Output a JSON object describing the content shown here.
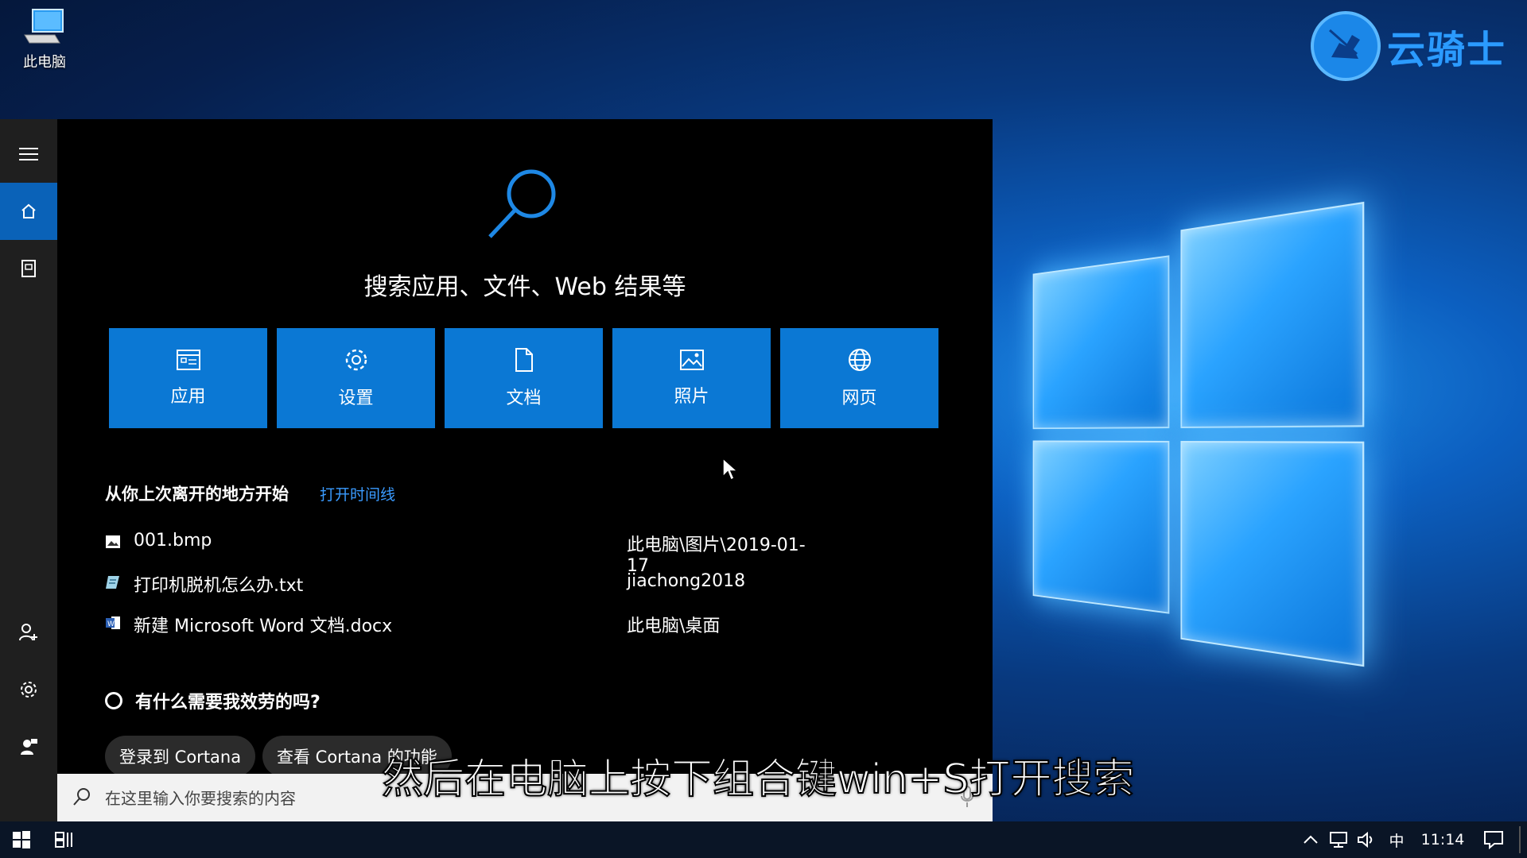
{
  "desktop": {
    "icon_label": "此电脑"
  },
  "brand": {
    "text": "云骑士"
  },
  "search_panel": {
    "headline": "搜索应用、文件、Web 结果等",
    "tiles": [
      {
        "label": "应用",
        "icon": "apps-icon"
      },
      {
        "label": "设置",
        "icon": "gear-icon"
      },
      {
        "label": "文档",
        "icon": "document-icon"
      },
      {
        "label": "照片",
        "icon": "photo-icon"
      },
      {
        "label": "网页",
        "icon": "globe-icon"
      }
    ],
    "recent": {
      "title": "从你上次离开的地方开始",
      "link": "打开时间线",
      "files": [
        {
          "name": "001.bmp",
          "path": "此电脑\\图片\\2019-01-17",
          "icon": "image-file-icon"
        },
        {
          "name": "打印机脱机怎么办.txt",
          "path": "jiachong2018",
          "icon": "text-file-icon"
        },
        {
          "name": "新建 Microsoft Word 文档.docx",
          "path": "此电脑\\桌面",
          "icon": "word-file-icon"
        }
      ]
    },
    "cortana": {
      "question": "有什么需要我效劳的吗?",
      "buttons": [
        "登录到 Cortana",
        "查看 Cortana 的功能"
      ]
    },
    "search_box": {
      "placeholder": "在这里输入你要搜索的内容",
      "value": ""
    }
  },
  "subtitle": "然后在电脑上按下组合键win+S打开搜索",
  "taskbar": {
    "ime": "中",
    "time": "11:14"
  },
  "colors": {
    "accent": "#0b78d4",
    "link": "#3a9bff",
    "rail_active": "#0a62b8"
  }
}
